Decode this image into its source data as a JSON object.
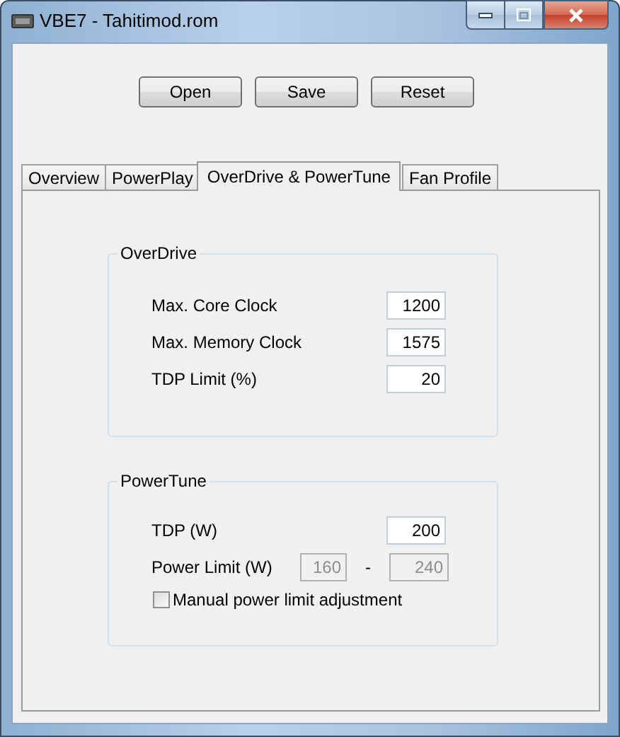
{
  "window": {
    "title": "VBE7 - Tahitimod.rom"
  },
  "buttons": [
    "Open",
    "Save",
    "Reset"
  ],
  "tabs": [
    {
      "label": "Overview",
      "selected": false
    },
    {
      "label": "PowerPlay",
      "selected": false
    },
    {
      "label": "OverDrive & PowerTune",
      "selected": true
    },
    {
      "label": "Fan Profile",
      "selected": false
    }
  ],
  "overdrive": {
    "title": "OverDrive",
    "fields": [
      {
        "label": "Max. Core Clock",
        "value": "1200"
      },
      {
        "label": "Max. Memory Clock",
        "value": "1575"
      },
      {
        "label": "TDP Limit (%)",
        "value": "20"
      }
    ]
  },
  "powertune": {
    "title": "PowerTune",
    "tdp": {
      "label": "TDP (W)",
      "value": "200"
    },
    "power_limit": {
      "label": "Power Limit (W)",
      "min": "160",
      "separator": "-",
      "max": "240",
      "disabled": true
    },
    "manual": {
      "label": "Manual power limit adjustment",
      "checked": false
    }
  }
}
